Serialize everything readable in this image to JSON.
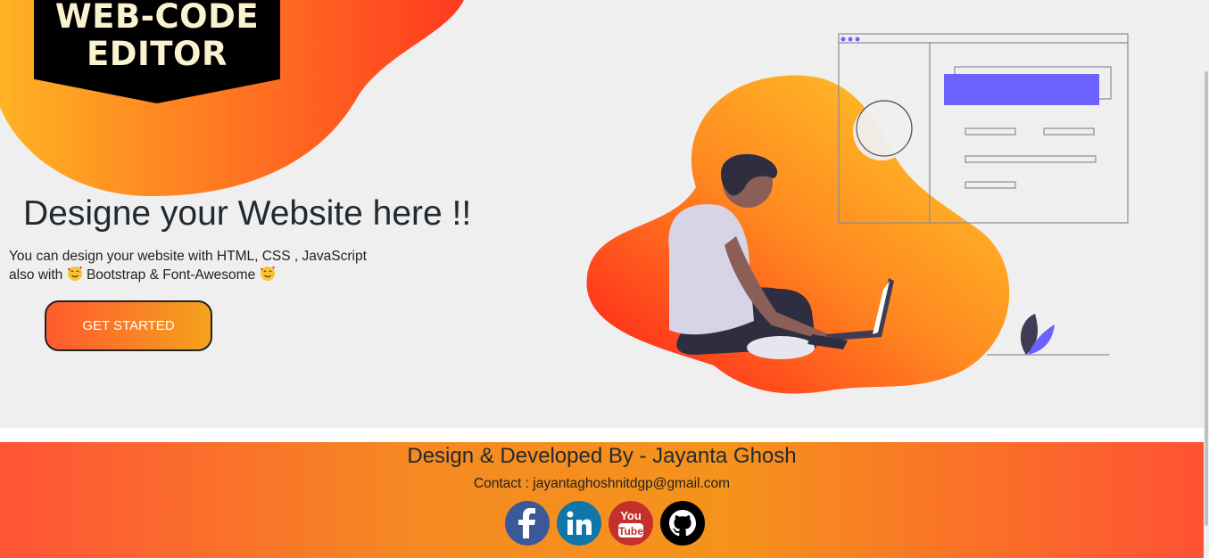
{
  "logo": {
    "line1": "WEB-CODE",
    "line2": "EDITOR"
  },
  "hero": {
    "title": "Designe your Website here !!",
    "desc_line1": "You can design your website with HTML, CSS , JavaScript",
    "desc_line2_a": "also with",
    "desc_line2_b": "Bootstrap & Font-Awesome",
    "cta": "GET STARTED"
  },
  "footer": {
    "title": "Design & Developed By - Jayanta Ghosh",
    "contact": "Contact : jayantaghoshnitdgp@gmail.com",
    "socials": [
      "facebook-icon",
      "linkedin-icon",
      "youtube-icon",
      "github-icon"
    ],
    "youtube_text_top": "You",
    "youtube_text_bottom": "Tube"
  },
  "colors": {
    "accent_orange": "#f5a21d",
    "accent_red": "#ff3d2a",
    "purple": "#6c63ff"
  }
}
